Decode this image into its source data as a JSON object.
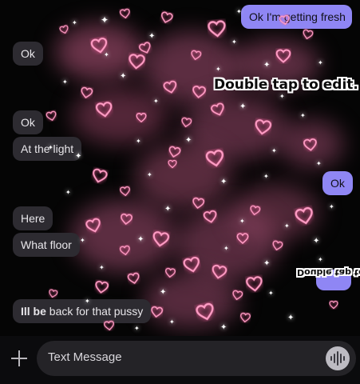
{
  "messages": [
    {
      "side": "out",
      "text": "Ok I'm getting fresh"
    },
    {
      "side": "in",
      "text": "Ok"
    },
    {
      "side": "in",
      "text": "Ok"
    },
    {
      "side": "in",
      "text": "At the light"
    },
    {
      "side": "out",
      "text": "Ok"
    },
    {
      "side": "in",
      "text": "Here"
    },
    {
      "side": "in",
      "text": "What floor"
    },
    {
      "side": "in",
      "text_bold": "Ill be",
      "text_rest": " back for that pussy"
    }
  ],
  "stickers": {
    "main": "Double tap to edit.",
    "mirrored": "Double tap to ed"
  },
  "composer": {
    "placeholder": "Text Message"
  },
  "icons": {
    "attach": "plus-icon",
    "voice": "voice-waveform-icon",
    "decor": "heart-icon"
  },
  "colors": {
    "outgoing_bubble": "#8f86f4",
    "incoming_bubble": "#2d2b31",
    "heart_glow": "#ff7fb0"
  }
}
